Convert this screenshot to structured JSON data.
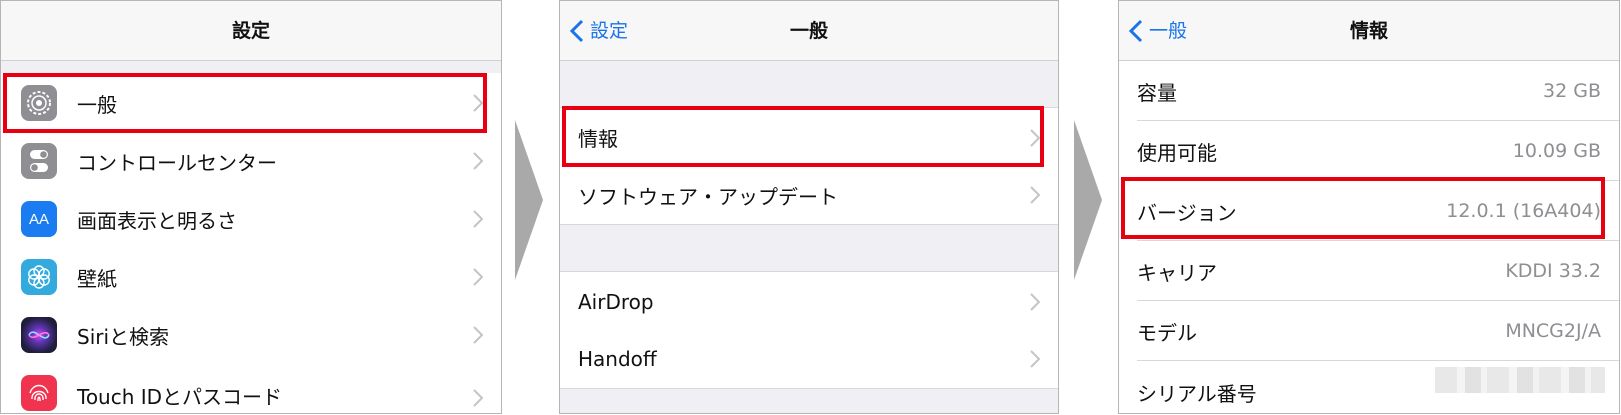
{
  "panel1": {
    "title": "設定",
    "items": [
      {
        "label": "一般",
        "icon": "gear-icon",
        "color": "#8e8e93"
      },
      {
        "label": "コントロールセンター",
        "icon": "toggle-switch-icon",
        "color": "#8e8e93"
      },
      {
        "label": "画面表示と明るさ",
        "icon": "text-size-icon",
        "icon_text": "AA",
        "color": "#1a7cf0"
      },
      {
        "label": "壁紙",
        "icon": "flower-icon",
        "color": "#33aadd"
      },
      {
        "label": "Siriと検索",
        "icon": "siri-icon",
        "color": "#222244"
      },
      {
        "label": "Touch IDとパスコード",
        "icon": "fingerprint-icon",
        "color": "#f0344f"
      }
    ]
  },
  "panel2": {
    "back_label": "設定",
    "title": "一般",
    "items": [
      {
        "label": "情報"
      },
      {
        "label": "ソフトウェア・アップデート"
      },
      {
        "label": "AirDrop"
      },
      {
        "label": "Handoff"
      }
    ]
  },
  "panel3": {
    "back_label": "一般",
    "title": "情報",
    "rows": [
      {
        "label": "容量",
        "value": "32 GB"
      },
      {
        "label": "使用可能",
        "value": "10.09 GB"
      },
      {
        "label": "バージョン",
        "value": "12.0.1 (16A404)"
      },
      {
        "label": "キャリア",
        "value": "KDDI 33.2"
      },
      {
        "label": "モデル",
        "value": "MNCG2J/A"
      },
      {
        "label": "シリアル番号",
        "value": ""
      }
    ]
  },
  "colors": {
    "highlight": "#e60012",
    "link": "#1a73e8",
    "arrow": "#a9a9a9"
  }
}
